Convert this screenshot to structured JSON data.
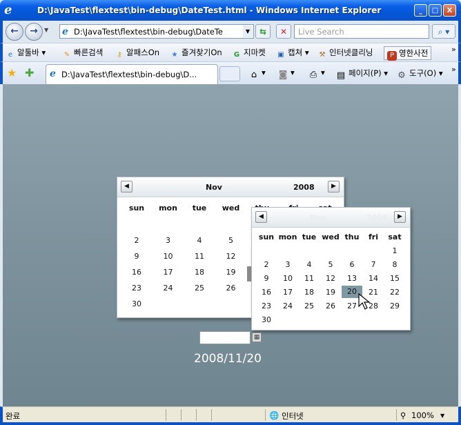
{
  "window": {
    "title": "D:\\JavaTest\\flextest\\bin-debug\\DateTest.html - Windows Internet Explorer",
    "controls": [
      "_",
      "□",
      "X"
    ]
  },
  "address_bar": {
    "url": "D:\\JavaTest\\flextest\\bin-debug\\DateTe",
    "search_placeholder": "Live Search"
  },
  "links_toolbar": {
    "items": [
      "알툴바",
      "빠른검색",
      "알패스On",
      "즐겨찾기On",
      "지마켓",
      "캡쳐",
      "인터넷클리닝",
      "영한사전"
    ]
  },
  "tab_bar": {
    "tab_label": "D:\\JavaTest\\flextest\\bin-debug\\D...",
    "page_menu": "페이지(P)",
    "tools_menu": "도구(O)"
  },
  "calendar_back": {
    "month": "Nov",
    "year": "2008",
    "weekdays": [
      "sun",
      "mon",
      "tue",
      "wed",
      "thu",
      "fri",
      "sat"
    ],
    "rows": [
      [
        "",
        "",
        "",
        "",
        "",
        "",
        ""
      ],
      [
        "2",
        "3",
        "4",
        "5",
        "",
        "",
        ""
      ],
      [
        "9",
        "10",
        "11",
        "12",
        "",
        "",
        ""
      ],
      [
        "16",
        "17",
        "18",
        "19",
        "",
        "",
        ""
      ],
      [
        "23",
        "24",
        "25",
        "26",
        "",
        "",
        ""
      ],
      [
        "30",
        "",
        "",
        "",
        "",
        "",
        ""
      ]
    ]
  },
  "calendar_front": {
    "month": "Nov",
    "year": "2008",
    "weekdays": [
      "sun",
      "mon",
      "tue",
      "wed",
      "thu",
      "fri",
      "sat"
    ],
    "rows": [
      [
        "",
        "",
        "",
        "",
        "",
        "",
        "1"
      ],
      [
        "2",
        "3",
        "4",
        "5",
        "6",
        "7",
        "8"
      ],
      [
        "9",
        "10",
        "11",
        "12",
        "13",
        "14",
        "15"
      ],
      [
        "16",
        "17",
        "18",
        "19",
        "20",
        "21",
        "22"
      ],
      [
        "23",
        "24",
        "25",
        "26",
        "27",
        "28",
        "29"
      ],
      [
        "30",
        "",
        "",
        "",
        "",
        "",
        ""
      ]
    ],
    "selected": "20"
  },
  "date_field": {
    "value": "",
    "display_text": "2008/11/20"
  },
  "status_bar": {
    "left": "완료",
    "zone": "인터넷",
    "zoom": "100%"
  }
}
